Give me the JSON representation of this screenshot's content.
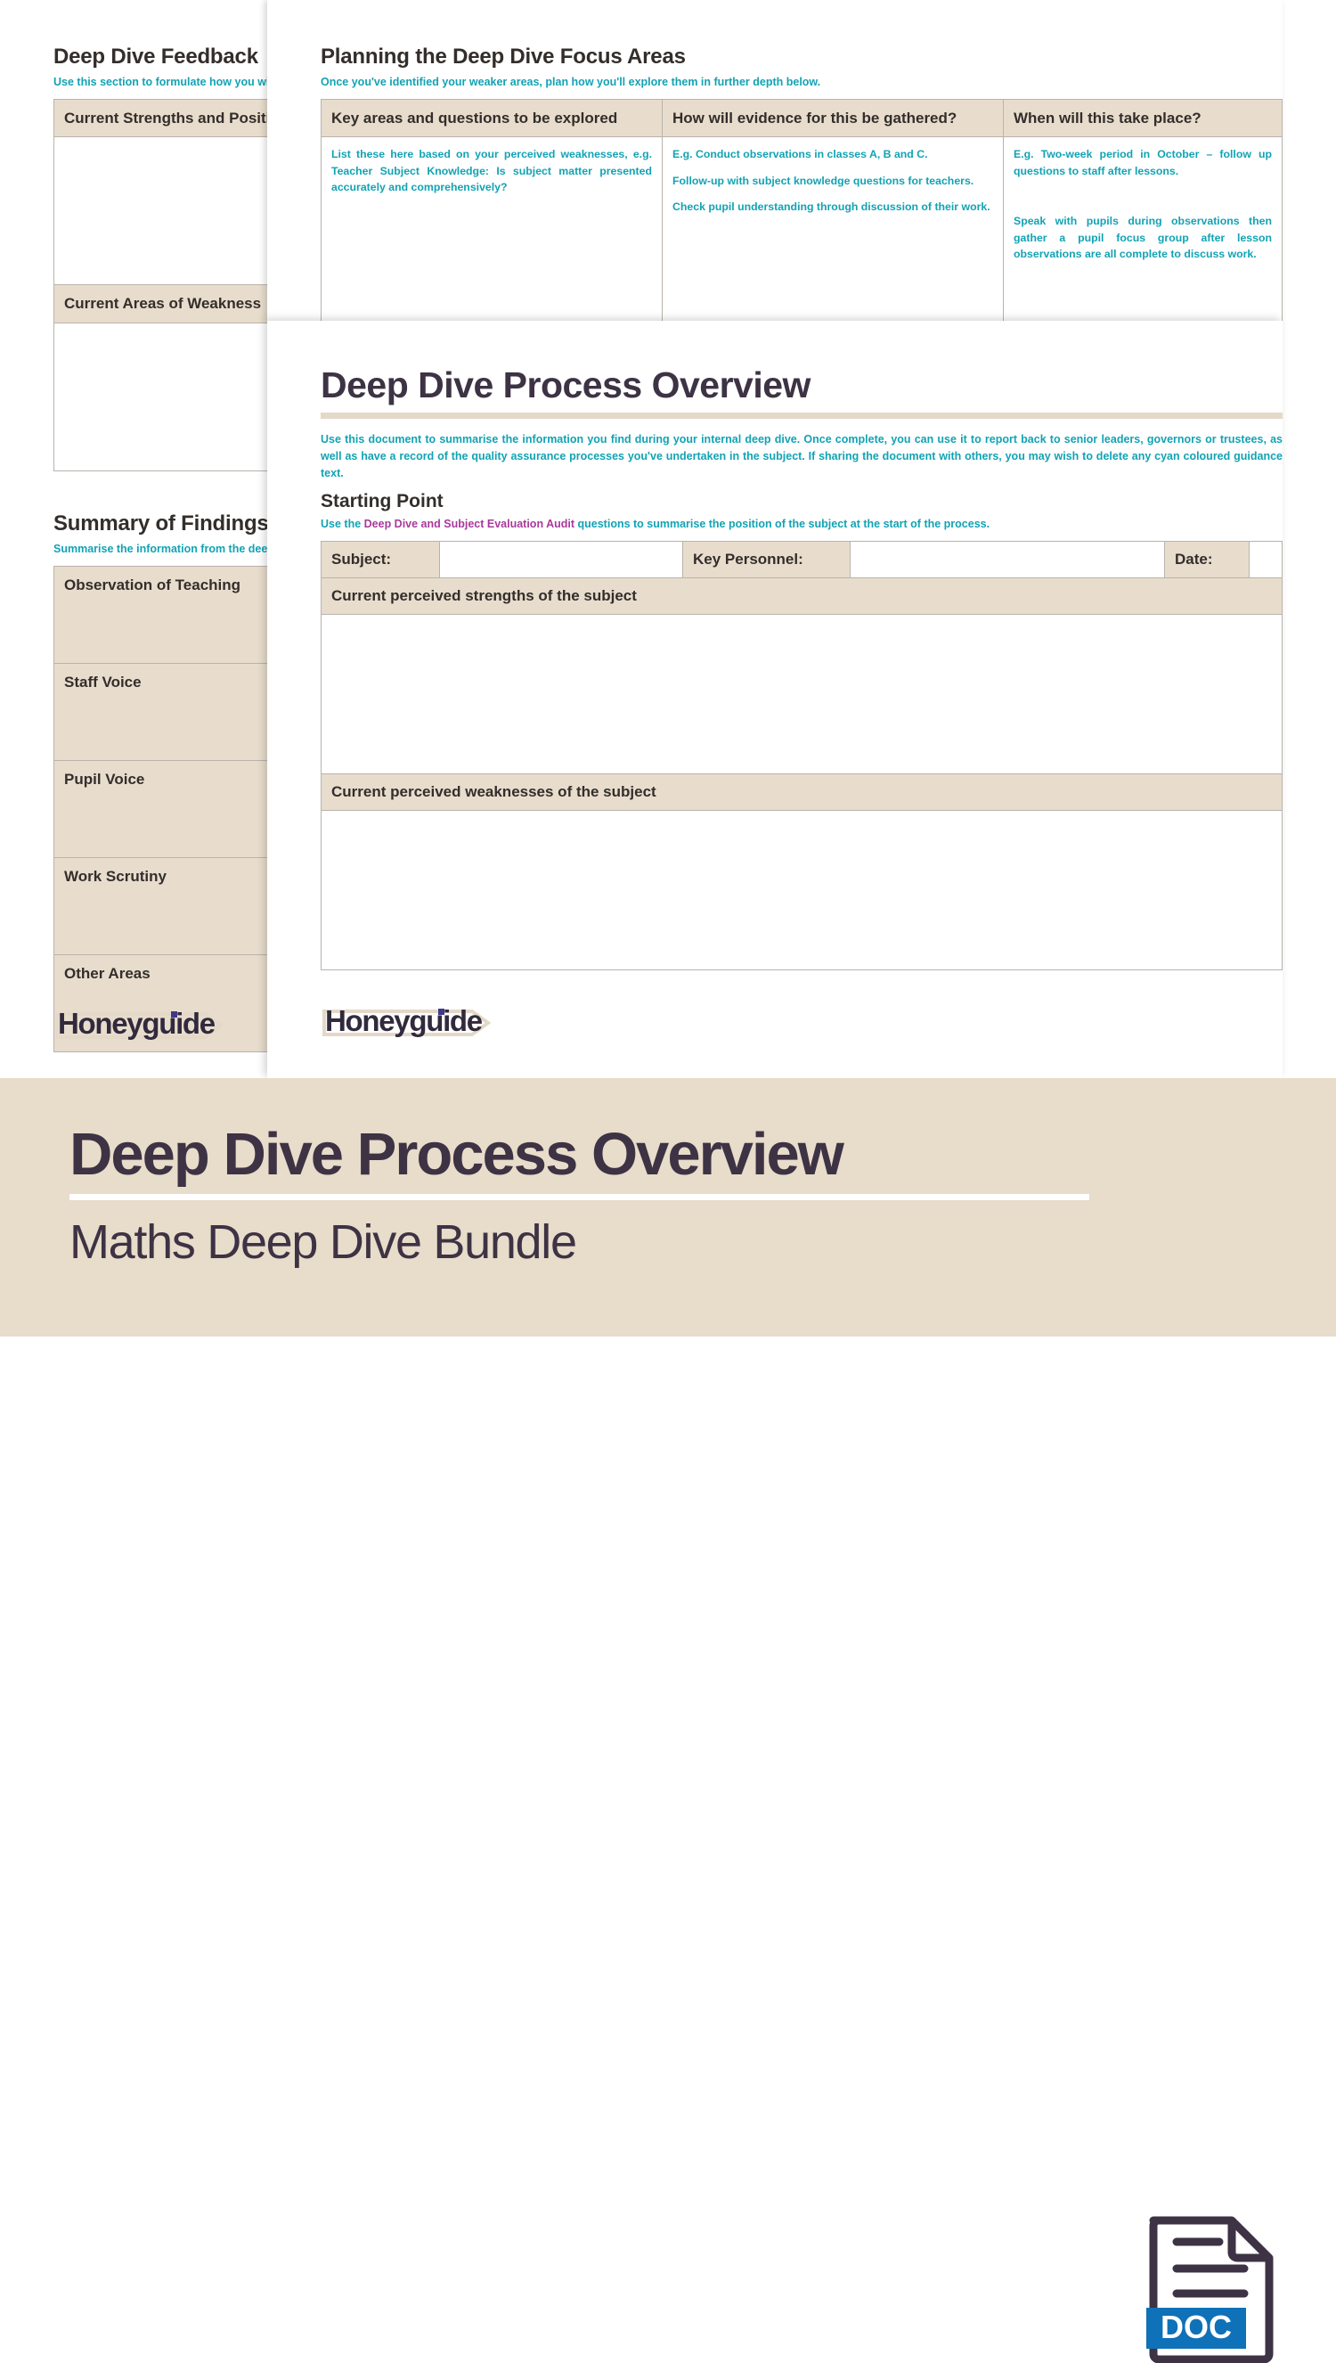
{
  "colors": {
    "accent_cyan": "#12a3b4",
    "link_purple": "#a9399c",
    "beige_cell": "#e8ddcd",
    "banner_bg": "#e8dcca",
    "ink": "#3d3344",
    "doc_blue": "#0f71b8"
  },
  "page_back": {
    "section_1": {
      "title": "Deep Dive Feedback",
      "guidance": "Use this section to formulate how you will feed back to staff and leaders.",
      "rows": [
        {
          "label": "Current Strengths and Positives"
        },
        {
          "label": "Current Areas of Weakness"
        }
      ]
    },
    "section_2": {
      "title": "Summary of Findings",
      "guidance": "Summarise the information from the deep dive activities you have undertaken against the key areas/questions you identified earlier.",
      "rows": [
        {
          "label": "Observation of Teaching"
        },
        {
          "label": "Staff Voice"
        },
        {
          "label": "Pupil Voice"
        },
        {
          "label": "Work Scrutiny"
        },
        {
          "label": "Other Areas"
        }
      ]
    },
    "logo": {
      "word": "Honeyguide"
    }
  },
  "page_mid": {
    "title": "Planning the Deep Dive Focus Areas",
    "guidance": "Once you've identified your weaker areas, plan how you'll explore them in further depth below.",
    "table": {
      "headers": [
        "Key areas and questions to be explored",
        "How will evidence for this be gathered?",
        "When will this take place?"
      ],
      "rows": [
        {
          "cells": [
            [
              "List these here based on your perceived weaknesses, e.g. Teacher Subject Knowledge: Is subject matter presented accurately and comprehensively?"
            ],
            [
              "E.g. Conduct observations in classes A, B and C.",
              "Follow-up with subject knowledge questions for teachers.",
              "Check pupil understanding through discussion of their work."
            ],
            [
              "E.g. Two-week period in October – follow up questions to staff after lessons.",
              "Speak with pupils during observations then gather a pupil focus group after lesson observations are all complete to discuss work."
            ]
          ]
        }
      ]
    }
  },
  "page_front": {
    "title": "Deep Dive Process Overview",
    "intro": "Use this document to summarise the information you find during your internal deep dive. Once complete, you can use it to report back to senior leaders, governors or trustees, as well as have a record of the quality assurance processes you've undertaken in the subject. If sharing the document with others, you may wish to delete any cyan coloured guidance text.",
    "section_heading": "Starting Point",
    "section_guidance_prefix": "Use the ",
    "section_guidance_link": "Deep Dive and Subject Evaluation Audit",
    "section_guidance_suffix": " questions to summarise the position of the subject at the start of the process.",
    "fields": {
      "subject_label": "Subject:",
      "subject_value": "",
      "key_personnel_label": "Key Personnel:",
      "key_personnel_value": "",
      "date_label": "Date:",
      "date_value": ""
    },
    "bands": {
      "strengths": "Current perceived strengths of the subject",
      "weaknesses": "Current perceived weaknesses of the subject"
    },
    "logo": {
      "word": "Honeyguide"
    }
  },
  "banner": {
    "title": "Deep Dive Process Overview",
    "subtitle": "Maths Deep Dive Bundle",
    "file_badge": "DOC"
  }
}
